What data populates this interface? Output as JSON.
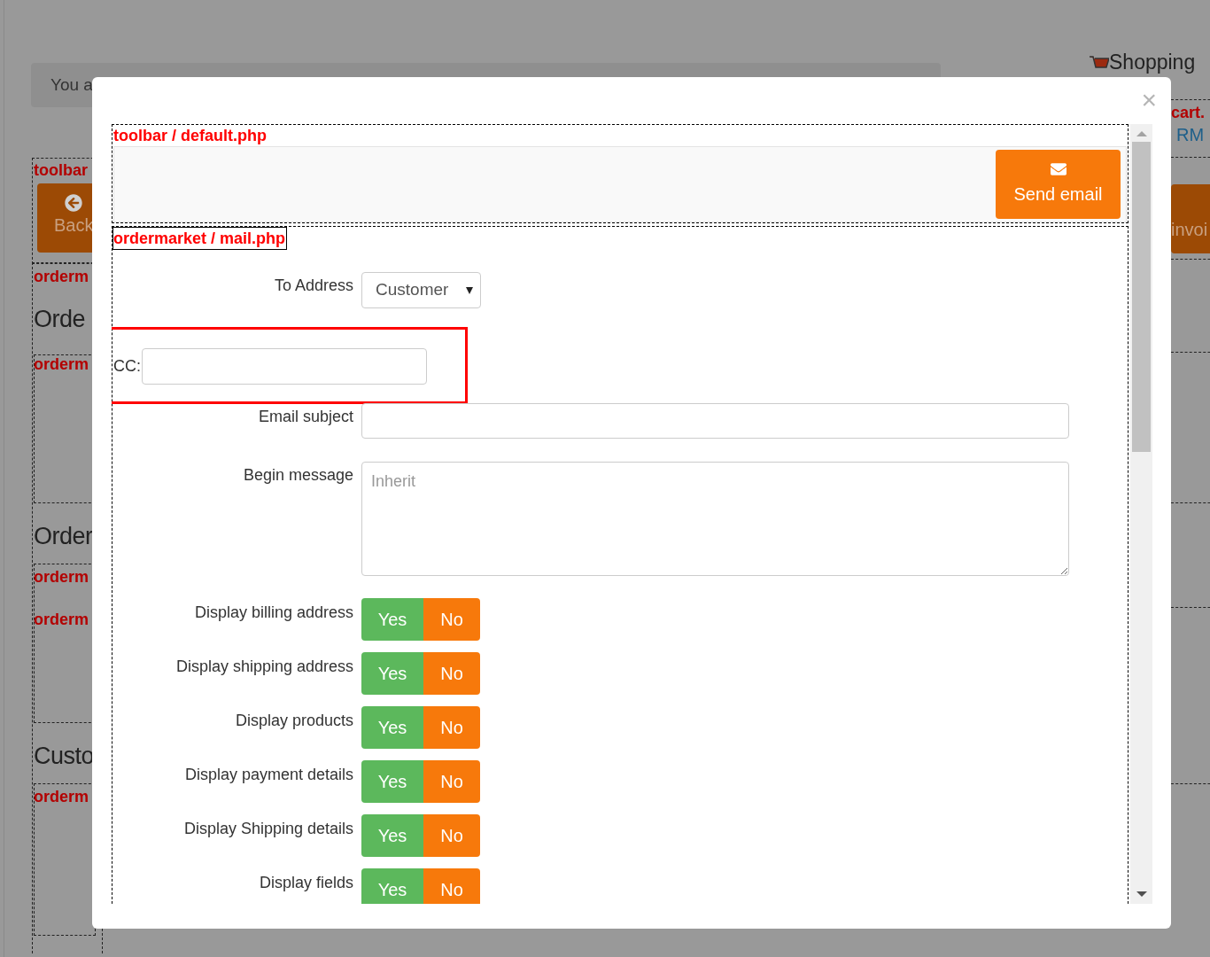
{
  "background": {
    "breadcrumb": "You a",
    "shopping": "Shopping",
    "left": [
      {
        "kind": "label",
        "text": "toolbar"
      },
      {
        "kind": "button",
        "text": "Back"
      },
      {
        "kind": "label",
        "text": "orderm"
      },
      {
        "kind": "heading",
        "text": "Orde"
      },
      {
        "kind": "label",
        "text": "orderm"
      },
      {
        "kind": "heading",
        "text": "Order"
      },
      {
        "kind": "label",
        "text": "orderm"
      },
      {
        "kind": "label",
        "text": "orderm"
      },
      {
        "kind": "heading",
        "text": "Custo"
      },
      {
        "kind": "label",
        "text": "orderm"
      }
    ],
    "right": [
      {
        "kind": "label",
        "text": "cart."
      },
      {
        "kind": "link",
        "text": "RM"
      },
      {
        "kind": "button",
        "text": "invoi"
      }
    ]
  },
  "modal": {
    "close": "×",
    "toolbar_label": "toolbar / default.php",
    "send_button": "Send email",
    "form_label": "ordermarket / mail.php",
    "to_address": {
      "label": "To Address",
      "value": "Customer"
    },
    "cc": {
      "label": "CC:"
    },
    "subject": {
      "label": "Email subject"
    },
    "message": {
      "label": "Begin message",
      "placeholder": "Inherit"
    },
    "toggles": [
      {
        "label": "Display billing address",
        "yes": "Yes",
        "no": "No"
      },
      {
        "label": "Display shipping address",
        "yes": "Yes",
        "no": "No"
      },
      {
        "label": "Display products",
        "yes": "Yes",
        "no": "No"
      },
      {
        "label": "Display payment details",
        "yes": "Yes",
        "no": "No"
      },
      {
        "label": "Display Shipping details",
        "yes": "Yes",
        "no": "No"
      },
      {
        "label": "Display fields",
        "yes": "Yes",
        "no": "No"
      }
    ]
  }
}
